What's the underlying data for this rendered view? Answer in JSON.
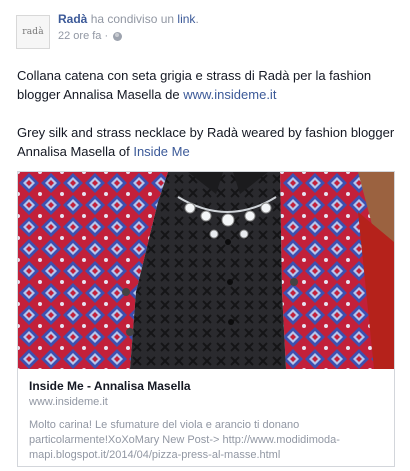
{
  "post": {
    "author": "Radà",
    "action_prefix": "ha condiviso un",
    "action_link": "link",
    "action_suffix": ".",
    "timestamp": "22 ore fa",
    "privacy_icon": "globe-icon",
    "avatar_logo_text": "radà",
    "message_it_prefix": "Collana catena con seta grigia e strass di Radà per la fashion blogger Annalisa Masella de ",
    "message_it_link": "www.insideme.it",
    "message_en_prefix": "Grey silk and strass necklace by Radà weared by fashion blogger Annalisa Masella of ",
    "message_en_link": "Inside Me"
  },
  "attachment": {
    "title": "Inside Me - Annalisa Masella",
    "domain": "www.insideme.it",
    "description": "Molto carina! Le sfumature del viola e arancio ti donano particolarmente!XoXoMary New Post-> http://www.modidimoda-mapi.blogspot.it/2014/04/pizza-press-al-masse.html"
  },
  "colors": {
    "link": "#3b5998",
    "meta": "#9197a3",
    "text": "#141823",
    "border": "#d3d6db"
  }
}
